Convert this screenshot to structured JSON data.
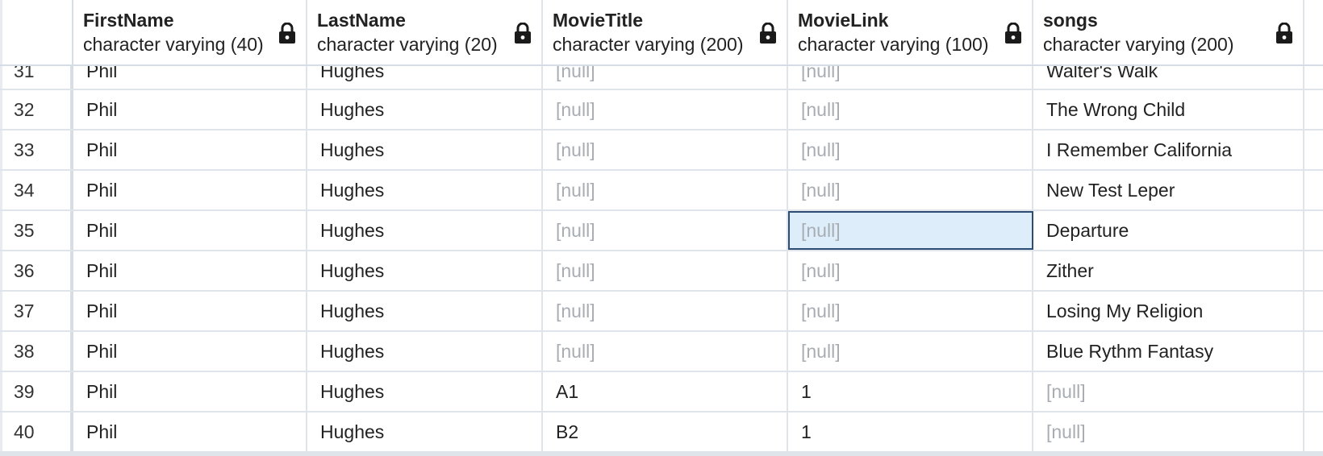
{
  "columns": [
    {
      "name": "FirstName",
      "type": "character varying (40)"
    },
    {
      "name": "LastName",
      "type": "character varying (20)"
    },
    {
      "name": "MovieTitle",
      "type": "character varying (200)"
    },
    {
      "name": "MovieLink",
      "type": "character varying (100)"
    },
    {
      "name": "songs",
      "type": "character varying (200)"
    }
  ],
  "header_icon": "lock-icon",
  "null_text": "[null]",
  "selected_cell": {
    "row": 35,
    "column": "MovieLink"
  },
  "rows": [
    {
      "num": "31",
      "cells": [
        "Phil",
        "Hughes",
        null,
        null,
        "Walter's Walk"
      ]
    },
    {
      "num": "32",
      "cells": [
        "Phil",
        "Hughes",
        null,
        null,
        "The Wrong Child"
      ]
    },
    {
      "num": "33",
      "cells": [
        "Phil",
        "Hughes",
        null,
        null,
        "I Remember California"
      ]
    },
    {
      "num": "34",
      "cells": [
        "Phil",
        "Hughes",
        null,
        null,
        "New Test Leper"
      ]
    },
    {
      "num": "35",
      "cells": [
        "Phil",
        "Hughes",
        null,
        null,
        "Departure"
      ]
    },
    {
      "num": "36",
      "cells": [
        "Phil",
        "Hughes",
        null,
        null,
        "Zither"
      ]
    },
    {
      "num": "37",
      "cells": [
        "Phil",
        "Hughes",
        null,
        null,
        "Losing My Religion"
      ]
    },
    {
      "num": "38",
      "cells": [
        "Phil",
        "Hughes",
        null,
        null,
        "Blue Rythm Fantasy"
      ]
    },
    {
      "num": "39",
      "cells": [
        "Phil",
        "Hughes",
        "A1",
        "1",
        null
      ]
    },
    {
      "num": "40",
      "cells": [
        "Phil",
        "Hughes",
        "B2",
        "1",
        null
      ]
    }
  ],
  "colors": {
    "grid_line": "#dfe3ea",
    "null_text": "#a8adb3",
    "selected_bg": "#ddeefa",
    "selected_border": "#2d4d74"
  }
}
